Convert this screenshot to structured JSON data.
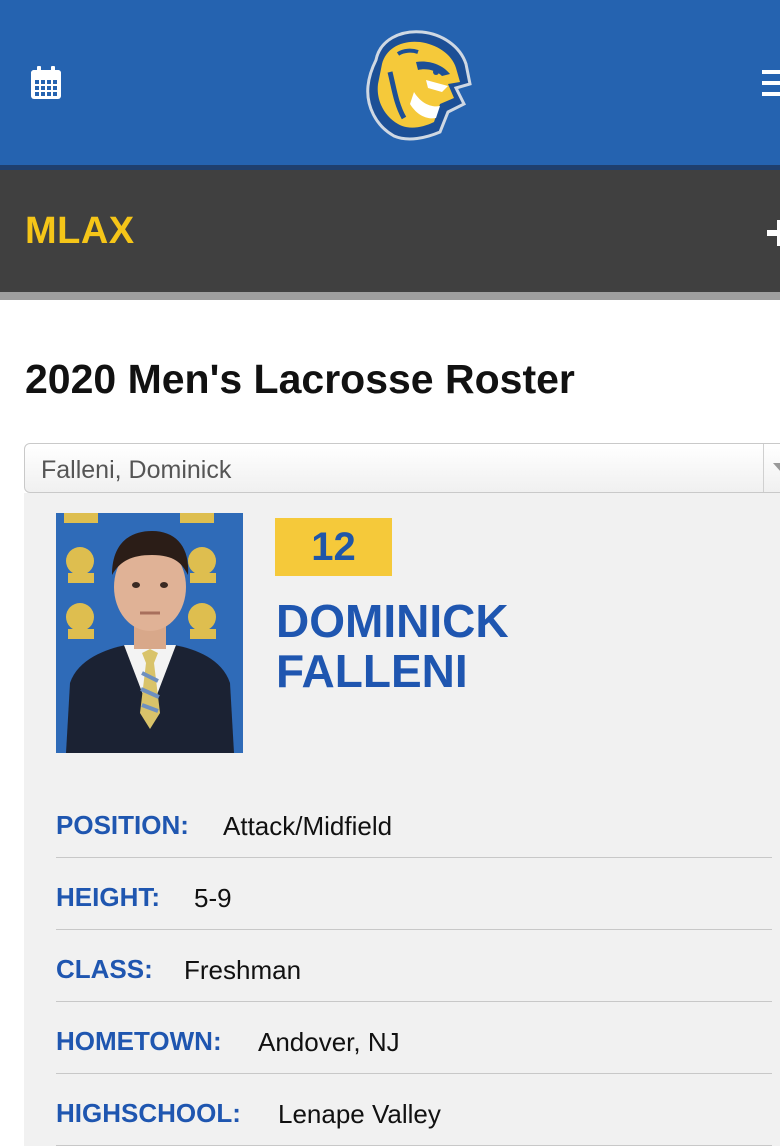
{
  "header": {
    "calendar_icon": "calendar-icon",
    "logo_icon": "tiger-logo",
    "menu_icon": "hamburger-menu-icon",
    "brand_color": "#2563b0",
    "accent_color": "#f5c518"
  },
  "subnav": {
    "title": "MLAX",
    "expand_icon": "plus-icon"
  },
  "page": {
    "title": "2020 Men's Lacrosse Roster"
  },
  "roster_select": {
    "selected": "Falleni, Dominick"
  },
  "player": {
    "number": "12",
    "first_name": "DOMINICK",
    "last_name": "FALLENI",
    "details": [
      {
        "label": "POSITION:",
        "value": "Attack/Midfield"
      },
      {
        "label": "HEIGHT:",
        "value": "5-9"
      },
      {
        "label": "CLASS:",
        "value": "Freshman"
      },
      {
        "label": "HOMETOWN:",
        "value": "Andover, NJ"
      },
      {
        "label": "HIGHSCHOOL:",
        "value": "Lenape Valley"
      }
    ]
  }
}
